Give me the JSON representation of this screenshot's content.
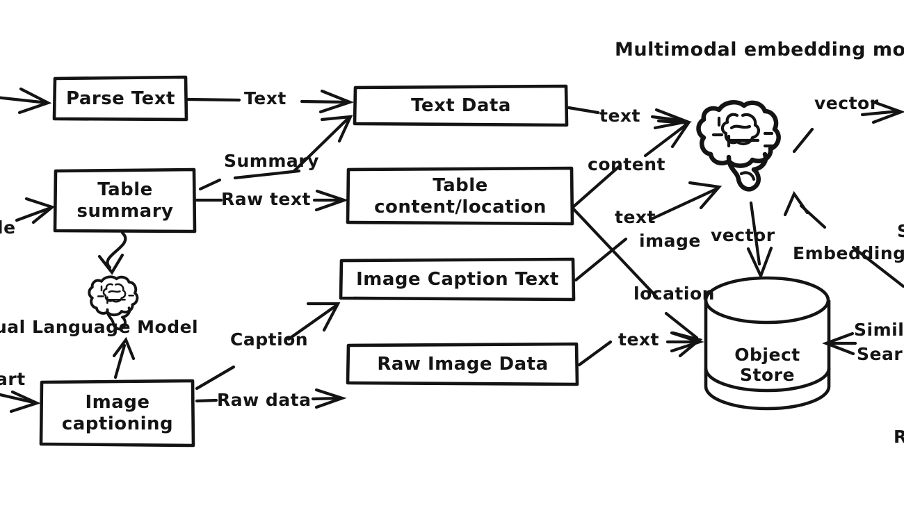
{
  "diagram": {
    "title": "Multimodal embedding model",
    "style": "hand-drawn flowchart",
    "bg_color": "#ffffff",
    "ink_color": "#141414"
  },
  "boxes": [
    {
      "id": "parse_text",
      "label": "Parse Text",
      "line1": "Parse Text",
      "line2": ""
    },
    {
      "id": "table_summary",
      "label": "Table summary",
      "line1": "Table",
      "line2": "summary"
    },
    {
      "id": "image_caption",
      "label": "Image captioning",
      "line1": "Image",
      "line2": "captioning"
    },
    {
      "id": "text_data",
      "label": "Text Data",
      "line1": "Text Data",
      "line2": ""
    },
    {
      "id": "table_content",
      "label": "Table content/location",
      "line1": "Table",
      "line2": "content/location"
    },
    {
      "id": "caption_text",
      "label": "Image Caption Text",
      "line1": "Image Caption Text",
      "line2": ""
    },
    {
      "id": "raw_image",
      "label": "Raw Image Data",
      "line1": "Raw Image Data",
      "line2": ""
    }
  ],
  "nodes": {
    "brain_embed": {
      "icon": "brain-icon",
      "caption": "Multimodal embedding model"
    },
    "brain_vlm": {
      "icon": "brain-icon",
      "caption": "Visual Language Model"
    },
    "object_store": {
      "icon": "cylinder-database-icon",
      "line1": "Object",
      "line2": "Store"
    }
  },
  "edge_labels": {
    "in_text": "Text",
    "in_summary": "Summary",
    "in_raw_text": "Raw text",
    "in_caption": "Caption",
    "in_raw_data": "Raw data",
    "to_brain_text": "text",
    "to_brain_content": "content",
    "to_brain_text2": "text",
    "to_brain_image": "image",
    "out_vector": "vector",
    "store_vector": "vector",
    "store_location": "location",
    "store_text": "text",
    "embedding": "Embedding"
  },
  "clipped_labels": {
    "left_table": "le",
    "left_chart": "art",
    "vlm_caption": "ual Language Model",
    "similarity_1": "Simila",
    "similarity_2": "Sear",
    "right_s": "S",
    "right_r": "R"
  }
}
